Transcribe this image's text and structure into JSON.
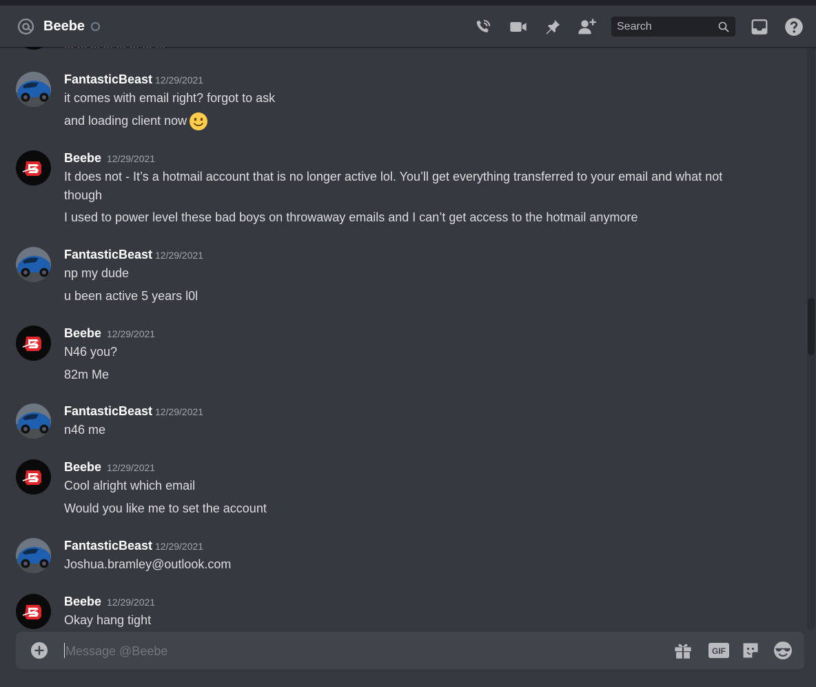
{
  "header": {
    "title": "Beebe",
    "search_placeholder": "Search"
  },
  "partial_message": {
    "text": "... ... ... ... ... ... ... ..."
  },
  "messages": [
    {
      "author": "FantasticBeast",
      "timestamp": "12/29/2021",
      "lines": [
        "it comes with email right? forgot to ask",
        "and loading client now"
      ],
      "avatar": "car-avatar"
    },
    {
      "author": "Beebe",
      "timestamp": "12/29/2021",
      "lines": [
        "It does not - It’s a hotmail account that is no longer active lol. You’ll get everything transferred to your email and what not though",
        "I used to power level these bad boys on throwaway emails and I can’t get access to the hotmail anymore"
      ],
      "avatar": "logo-avatar"
    },
    {
      "author": "FantasticBeast",
      "timestamp": "12/29/2021",
      "lines": [
        "np my dude",
        "u been active 5 years l0l"
      ],
      "avatar": "car-avatar"
    },
    {
      "author": "Beebe",
      "timestamp": "12/29/2021",
      "lines": [
        "N46 you?",
        "82m Me"
      ],
      "avatar": "logo-avatar"
    },
    {
      "author": "FantasticBeast",
      "timestamp": "12/29/2021",
      "lines": [
        "n46 me"
      ],
      "avatar": "car-avatar"
    },
    {
      "author": "Beebe",
      "timestamp": "12/29/2021",
      "lines": [
        "Cool alright which email",
        "Would you like me to set the account"
      ],
      "avatar": "logo-avatar"
    },
    {
      "author": "FantasticBeast",
      "timestamp": "12/29/2021",
      "lines": [
        "Joshua.bramley@outlook.com"
      ],
      "avatar": "car-avatar"
    },
    {
      "author": "Beebe",
      "timestamp": "12/29/2021",
      "lines": [
        "Okay hang tight"
      ],
      "avatar": "logo-avatar"
    }
  ],
  "composer": {
    "placeholder": "Message @Beebe",
    "gif_label": "GIF"
  },
  "icons": {
    "at": "at-icon",
    "status": "idle-status-icon",
    "call": "phone-call-icon",
    "video": "video-camera-icon",
    "pin": "pin-icon",
    "add_friend": "add-friend-icon",
    "search": "search-icon",
    "inbox": "inbox-icon",
    "help": "help-icon",
    "plus": "plus-circle-icon",
    "gift": "gift-icon",
    "gif": "gif-icon",
    "sticker": "sticker-icon",
    "emoji": "emoji-icon",
    "smile": "smiling-face-emoji"
  },
  "colors": {
    "background": "#36393f",
    "header_text": "#ffffff",
    "message_text": "#dcddde",
    "timestamp": "#a3a6aa",
    "composer_bg": "#40444b",
    "search_bg": "#202225",
    "icon": "#b9bbbe"
  }
}
